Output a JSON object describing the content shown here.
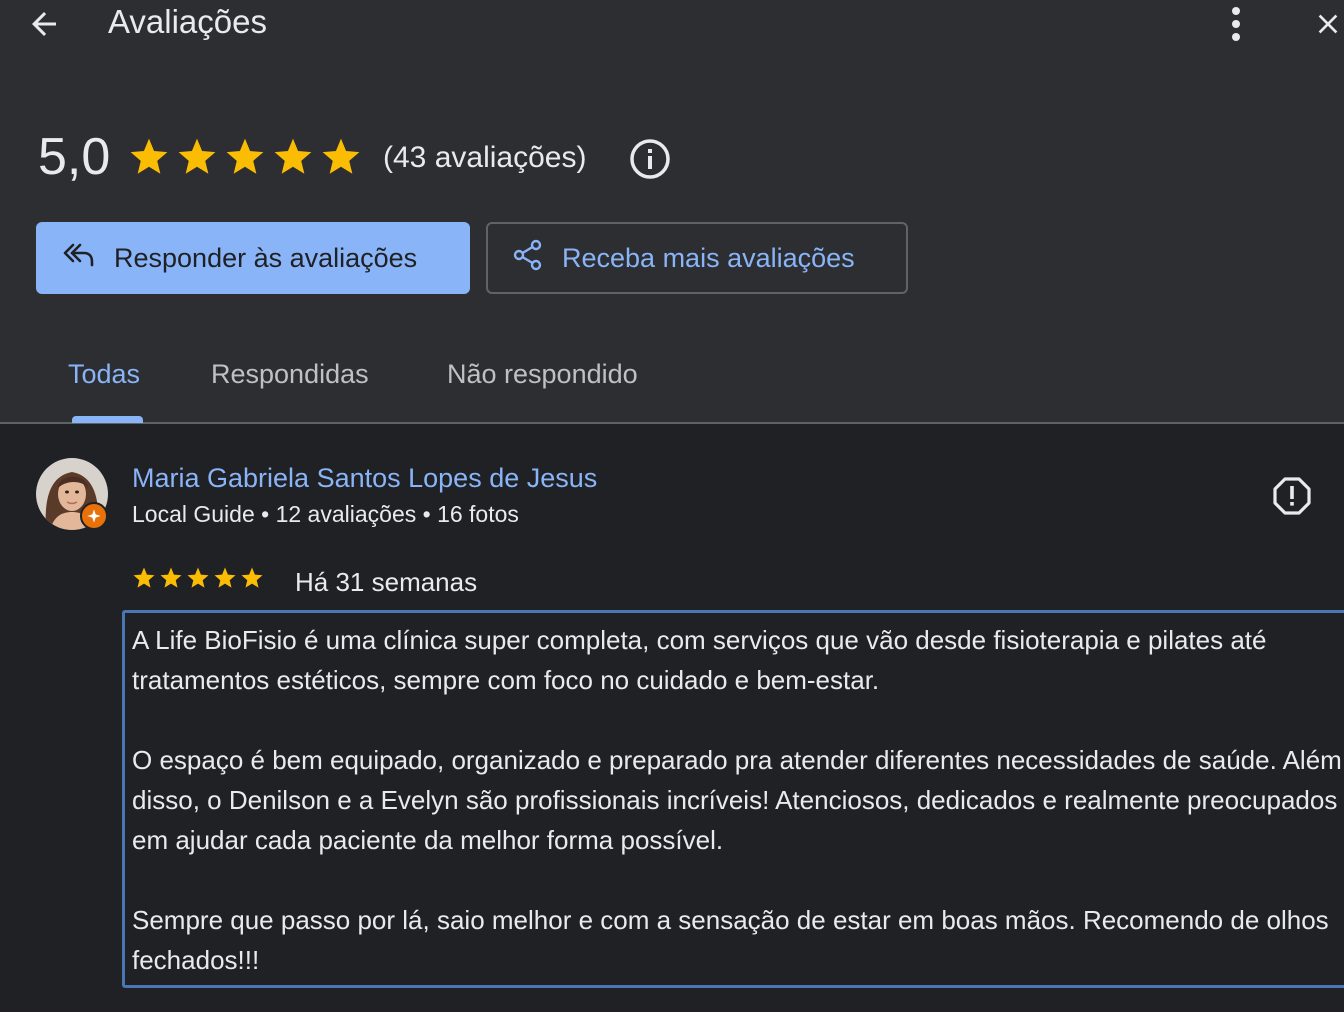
{
  "header": {
    "title": "Avaliações",
    "back_icon": "arrow-left-icon",
    "more_icon": "more-vert-icon",
    "close_icon": "close-icon"
  },
  "summary": {
    "rating": "5,0",
    "stars": 5,
    "count_text": "(43 avaliações)",
    "info_icon": "info-icon",
    "star_color": "#fbbc04"
  },
  "actions": {
    "respond_label": "Responder às avaliações",
    "respond_icon": "reply-all-icon",
    "get_more_label": "Receba mais avaliações",
    "get_more_icon": "share-icon",
    "accent_color": "#8ab4f8"
  },
  "tabs": [
    {
      "label": "Todas",
      "active": true
    },
    {
      "label": "Respondidas",
      "active": false
    },
    {
      "label": "Não respondido",
      "active": false
    }
  ],
  "review": {
    "name": "Maria Gabriela Santos Lopes de Jesus",
    "meta": "Local Guide • 12 avaliações • 16 fotos",
    "stars": 5,
    "time": "Há 31 semanas",
    "paragraphs": [
      "A Life BioFisio é uma clínica super completa, com serviços que vão desde fisioterapia e pilates até tratamentos estéticos, sempre com foco no cuidado e bem-estar.",
      "O espaço é bem equipado, organizado e preparado pra atender diferentes necessidades de saúde. Além disso, o Denilson e a Evelyn são profissionais incríveis! Atenciosos, dedicados e realmente preocupados em ajudar cada paciente da melhor forma possível.",
      "Sempre que passo por lá, saio melhor e com a sensação de estar em boas mãos. Recomendo de olhos fechados!!!"
    ],
    "report_icon": "report-icon",
    "badge_icon": "local-guide-badge-icon"
  }
}
